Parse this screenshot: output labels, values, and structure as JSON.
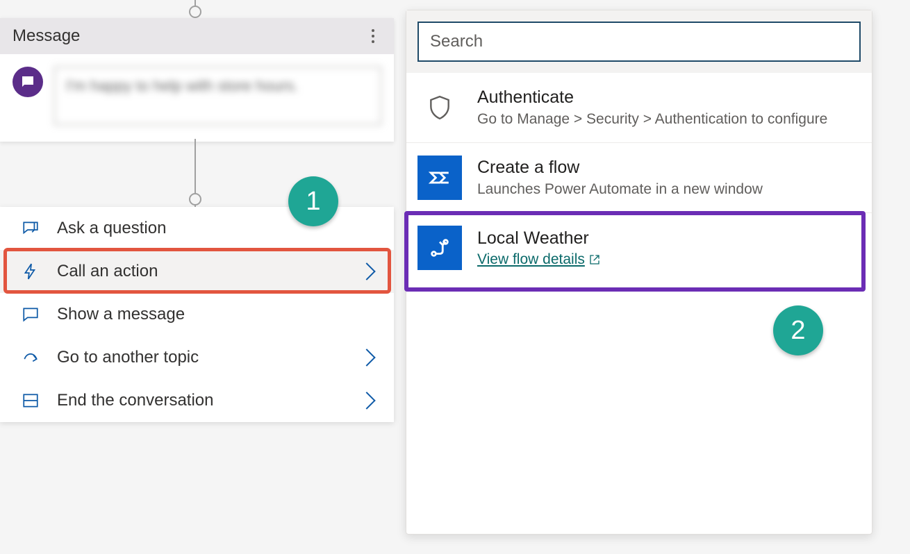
{
  "message_card": {
    "title": "Message",
    "body_text": "I'm happy to help with store hours."
  },
  "node_menu": {
    "items": [
      {
        "label": "Ask a question",
        "has_chevron": false,
        "icon": "chat-question-icon"
      },
      {
        "label": "Call an action",
        "has_chevron": true,
        "icon": "lightning-icon",
        "highlighted": true
      },
      {
        "label": "Show a message",
        "has_chevron": false,
        "icon": "chat-icon"
      },
      {
        "label": "Go to another topic",
        "has_chevron": true,
        "icon": "redirect-icon"
      },
      {
        "label": "End the conversation",
        "has_chevron": true,
        "icon": "panel-icon"
      }
    ]
  },
  "action_panel": {
    "search_placeholder": "Search",
    "items": [
      {
        "title": "Authenticate",
        "subtitle": "Go to Manage > Security > Authentication to configure",
        "icon_style": "shield"
      },
      {
        "title": "Create a flow",
        "subtitle": "Launches Power Automate in a new window",
        "icon_style": "flow-square"
      },
      {
        "title": "Local Weather",
        "link_text": "View flow details",
        "icon_style": "flow-run-square",
        "highlighted": true
      }
    ]
  },
  "callouts": {
    "one": "1",
    "two": "2"
  }
}
